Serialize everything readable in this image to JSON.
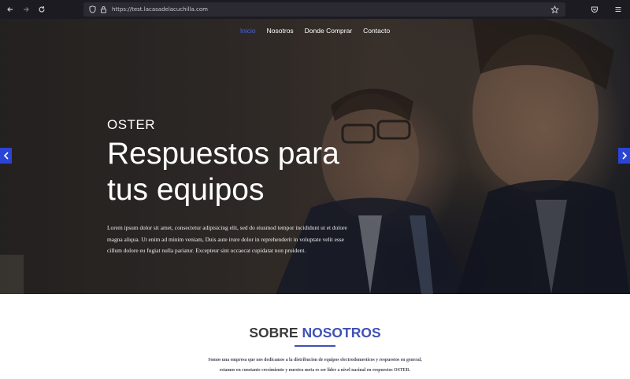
{
  "browser": {
    "url": "https://test.lacasadelacuchilla.com",
    "icons": [
      "back-arrow-icon",
      "forward-arrow-icon",
      "reload-icon",
      "shield-icon",
      "lock-icon",
      "bookmark-star-icon",
      "pocket-icon",
      "menu-icon"
    ]
  },
  "nav": {
    "items": [
      {
        "label": "Inicio",
        "active": true
      },
      {
        "label": "Nosotros",
        "active": false
      },
      {
        "label": "Donde Comprar",
        "active": false
      },
      {
        "label": "Contacto",
        "active": false
      }
    ]
  },
  "hero": {
    "brand": "OSTER",
    "headline_line1": "Respuestos para",
    "headline_line2": "tus equipos",
    "body": "Lorem ipsum dolor sit amet, consectetur adipisicing elit, sed do eiusmod tempor incididunt ut et dolore magna aliqua. Ut enim ad minim veniam, Duis aute irure dolor in reprehenderit in voluptate velit esse cillum dolore eu fugiat nulla pariatur. Excepteur sint occaecat cupidatat non proident.",
    "prev_icon": "chevron-left-icon",
    "next_icon": "chevron-right-icon"
  },
  "about": {
    "title_part1": "SOBRE",
    "title_part2": "NOSOTROS",
    "text_line1": "Somos una empresa que nos dedicamos a la distribucion de equipos electrodomesticos y respuestos en general,",
    "text_line2": "estamos en constante crecimiento y nuestra meta es ser lider a nivel nacinal en respuestos OSTER."
  },
  "colors": {
    "accent": "#3f51b5",
    "nav_active": "#4a63d8",
    "slider_arrow": "#2a45d6",
    "browser_chrome": "#1c1b22"
  }
}
